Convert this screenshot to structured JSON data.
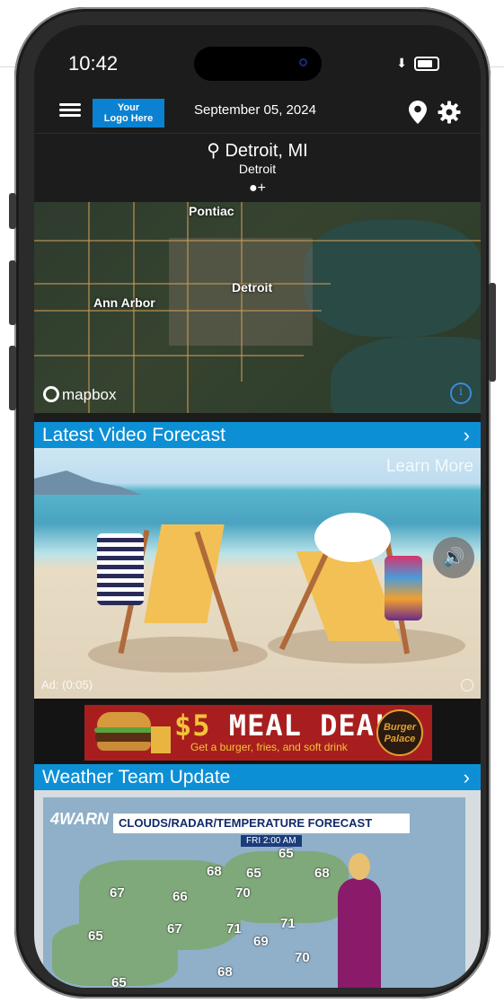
{
  "status": {
    "time": "10:42"
  },
  "app": {
    "logo_text": "Your\nLogo Here",
    "date": "September 05, 2024",
    "location": {
      "city": "Detroit, MI",
      "subtitle": "Detroit",
      "pager": "●+"
    }
  },
  "map": {
    "labels": [
      "Pontiac",
      "Ann Arbor",
      "Detroit"
    ],
    "attribution": "mapbox",
    "info_icon": "info-icon"
  },
  "video_section": {
    "title": "Latest Video Forecast",
    "chevron": "›"
  },
  "video": {
    "learn_more": "Learn More",
    "ad_label": "Ad: (0:05)"
  },
  "ad_banner": {
    "headline_amount": "$5",
    "headline": " MEAL DEAL",
    "subline": "Get a burger, fries, and soft drink",
    "brand": "Burger\nPalace"
  },
  "weather_section": {
    "title": "Weather Team Update",
    "chevron": "›"
  },
  "weather_video": {
    "station": "4WARN",
    "graphic_title": "CLOUDS/RADAR/TEMPERATURE FORECAST",
    "graphic_time": "FRI 2:00 AM",
    "temps": [
      "65",
      "68",
      "65",
      "68",
      "67",
      "66",
      "70",
      "67",
      "71",
      "71",
      "69",
      "65",
      "65",
      "70",
      "68"
    ]
  },
  "colors": {
    "accent": "#0d8fd6",
    "logo_bg": "#0a82d1",
    "ad_bg": "#a81e1e"
  }
}
